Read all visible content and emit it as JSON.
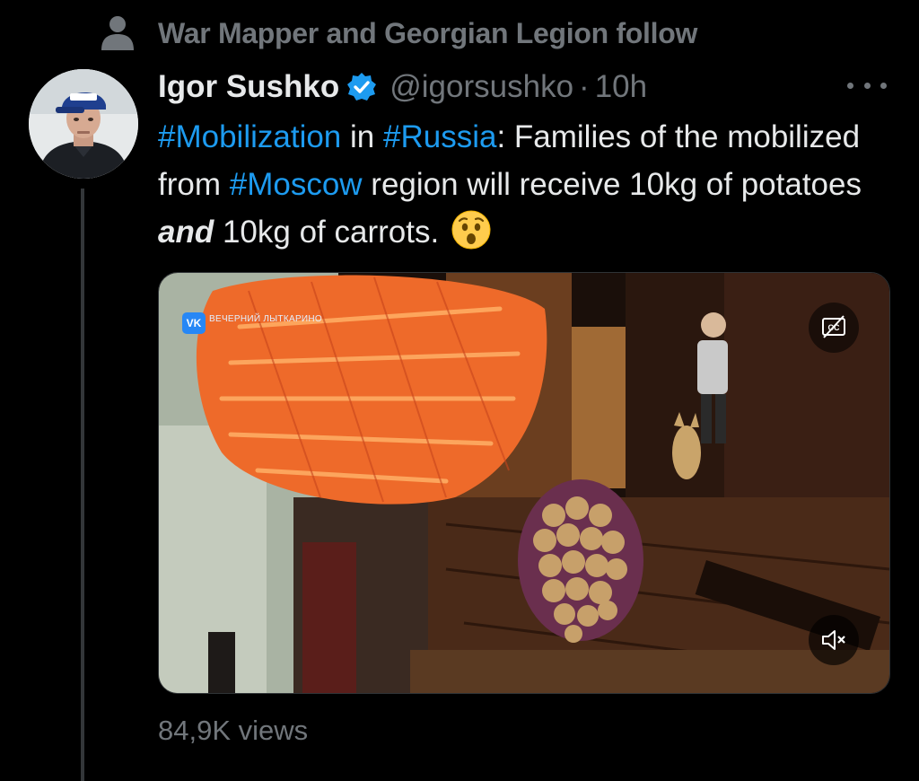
{
  "social_context": {
    "icon": "person-icon",
    "text": "War Mapper and Georgian Legion follow"
  },
  "tweet": {
    "author_name": "Igor Sushko",
    "verified": true,
    "handle": "@igorsushko",
    "separator": "·",
    "time": "10h",
    "text": {
      "t1": "#Mobilization",
      "t2": " in ",
      "t3": "#Russia",
      "t4": ": Families of the mobilized from ",
      "t5": "#Moscow",
      "t6": " region will receive 10kg of potatoes ",
      "t7": "and",
      "t8": " 10kg of carrots."
    },
    "emoji": "astonished-face",
    "views": "84,9K views"
  },
  "video": {
    "watermark_logo": "VK",
    "watermark_text": "ВЕЧЕРНИЙ ЛЫТКАРИНО",
    "cc_icon": "closed-captions-icon",
    "mute_icon": "volume-muted-icon"
  },
  "colors": {
    "background": "#000000",
    "primary_text": "#e7e9ea",
    "secondary_text": "#71767b",
    "link": "#1d9bf0",
    "verified": "#1d9bf0"
  }
}
